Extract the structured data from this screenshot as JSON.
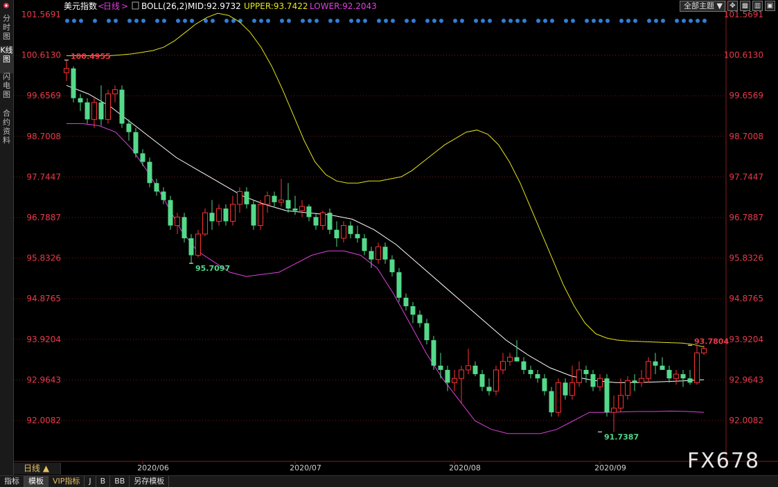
{
  "instrument": "美元指数",
  "period_label": "日线",
  "indicator": {
    "label": "BOLL(26,2)",
    "mid_label": "MID:92.9732",
    "upper_label": "UPPER:93.7422",
    "lower_label": "LOWER:92.2043"
  },
  "colors": {
    "up": "#ff3232",
    "down": "#54d98a",
    "mid": "#ffffff",
    "upper": "#e6e620",
    "lower": "#e040e0",
    "price_label": "#e83a4a",
    "grid": "#7a1a1a"
  },
  "sidebar_tabs": [
    "分时图",
    "K线图",
    "闪电图",
    "合约资料"
  ],
  "toolbar": {
    "theme_button": "全部主题",
    "theme_arrow": "▼"
  },
  "bottom_tabs": [
    "指标",
    "模板",
    "VIP指标",
    "J",
    "B",
    "BB",
    "另存模板"
  ],
  "period_tab": "日线 ▲",
  "watermark": "FX678",
  "chart_data": {
    "type": "candlestick",
    "title": "美元指数",
    "y_ticks": [
      "101.5691",
      "100.6130",
      "99.6569",
      "98.7008",
      "97.7447",
      "96.7887",
      "95.8326",
      "94.8765",
      "93.9204",
      "92.9643",
      "92.0082"
    ],
    "ylim": [
      91.4,
      101.6
    ],
    "x_ticks": [
      {
        "label": "2020/06",
        "index": 11
      },
      {
        "label": "2020/07",
        "index": 33
      },
      {
        "label": "2020/08",
        "index": 56
      },
      {
        "label": "2020/09",
        "index": 77
      }
    ],
    "annotations": [
      {
        "text": "100.4955",
        "index": 0,
        "value": 100.4955
      },
      {
        "text": "95.7097",
        "index": 18,
        "value": 95.7097
      },
      {
        "text": "91.7387",
        "index": 77,
        "value": 91.7387
      },
      {
        "text": "93.7804",
        "index": 90,
        "value": 93.7804
      }
    ],
    "ohlc": [
      [
        100.2,
        100.5,
        100.0,
        100.3
      ],
      [
        100.3,
        100.35,
        99.5,
        99.6
      ],
      [
        99.6,
        99.7,
        99.3,
        99.5
      ],
      [
        99.5,
        99.6,
        99.0,
        99.1
      ],
      [
        99.1,
        99.6,
        98.9,
        99.5
      ],
      [
        99.5,
        99.9,
        98.95,
        99.1
      ],
      [
        99.1,
        99.8,
        99.0,
        99.7
      ],
      [
        99.7,
        99.9,
        99.5,
        99.8
      ],
      [
        99.8,
        99.9,
        98.9,
        99.0
      ],
      [
        99.0,
        99.1,
        98.6,
        98.8
      ],
      [
        98.8,
        98.9,
        98.2,
        98.3
      ],
      [
        98.3,
        98.4,
        98.0,
        98.1
      ],
      [
        98.1,
        98.2,
        97.5,
        97.6
      ],
      [
        97.6,
        97.7,
        97.3,
        97.4
      ],
      [
        97.4,
        97.5,
        97.1,
        97.2
      ],
      [
        97.2,
        97.3,
        96.5,
        96.6
      ],
      [
        96.6,
        96.9,
        96.4,
        96.8
      ],
      [
        96.8,
        96.9,
        96.2,
        96.3
      ],
      [
        96.3,
        96.4,
        95.7,
        95.9
      ],
      [
        95.9,
        96.5,
        95.85,
        96.4
      ],
      [
        96.4,
        97.0,
        96.35,
        96.9
      ],
      [
        96.9,
        97.2,
        96.5,
        96.7
      ],
      [
        96.7,
        97.1,
        96.6,
        97.0
      ],
      [
        97.0,
        97.1,
        96.6,
        96.7
      ],
      [
        96.7,
        97.3,
        96.6,
        97.1
      ],
      [
        97.1,
        97.5,
        96.9,
        97.4
      ],
      [
        97.4,
        97.5,
        97.0,
        97.1
      ],
      [
        97.1,
        97.2,
        96.5,
        96.6
      ],
      [
        96.6,
        97.2,
        96.5,
        97.1
      ],
      [
        97.1,
        97.4,
        96.9,
        97.3
      ],
      [
        97.3,
        97.4,
        97.05,
        97.15
      ],
      [
        97.15,
        97.7,
        97.05,
        97.2
      ],
      [
        97.2,
        97.6,
        96.9,
        97.0
      ],
      [
        97.0,
        97.3,
        96.85,
        96.95
      ],
      [
        96.95,
        97.2,
        96.8,
        97.05
      ],
      [
        97.05,
        97.1,
        96.7,
        96.8
      ],
      [
        96.8,
        96.9,
        96.5,
        96.6
      ],
      [
        96.6,
        96.95,
        96.5,
        96.9
      ],
      [
        96.9,
        97.0,
        96.4,
        96.5
      ],
      [
        96.5,
        96.7,
        96.1,
        96.3
      ],
      [
        96.3,
        96.7,
        96.2,
        96.6
      ],
      [
        96.6,
        96.7,
        96.3,
        96.4
      ],
      [
        96.4,
        96.6,
        96.2,
        96.3
      ],
      [
        96.3,
        96.4,
        95.9,
        96.0
      ],
      [
        96.0,
        96.1,
        95.6,
        95.8
      ],
      [
        95.8,
        96.2,
        95.7,
        96.1
      ],
      [
        96.1,
        96.2,
        95.7,
        95.8
      ],
      [
        95.8,
        95.9,
        95.4,
        95.5
      ],
      [
        95.5,
        95.6,
        94.8,
        94.9
      ],
      [
        94.9,
        95.0,
        94.6,
        94.7
      ],
      [
        94.7,
        94.8,
        94.3,
        94.5
      ],
      [
        94.5,
        94.6,
        94.2,
        94.3
      ],
      [
        94.3,
        94.4,
        93.8,
        93.9
      ],
      [
        93.9,
        94.0,
        93.2,
        93.3
      ],
      [
        93.3,
        93.6,
        93.0,
        93.2
      ],
      [
        93.2,
        93.3,
        92.7,
        92.9
      ],
      [
        92.9,
        93.2,
        92.7,
        93.0
      ],
      [
        93.0,
        93.3,
        92.4,
        93.2
      ],
      [
        93.2,
        93.7,
        93.1,
        93.3
      ],
      [
        93.3,
        93.4,
        93.05,
        93.1
      ],
      [
        93.1,
        93.2,
        92.7,
        92.8
      ],
      [
        92.8,
        93.0,
        92.6,
        92.7
      ],
      [
        92.7,
        93.3,
        92.6,
        93.2
      ],
      [
        93.2,
        93.6,
        93.1,
        93.4
      ],
      [
        93.4,
        93.6,
        93.3,
        93.5
      ],
      [
        93.5,
        93.9,
        93.4,
        93.4
      ],
      [
        93.4,
        93.5,
        93.1,
        93.2
      ],
      [
        93.2,
        93.3,
        93.0,
        93.1
      ],
      [
        93.1,
        93.2,
        92.9,
        93.0
      ],
      [
        93.0,
        93.1,
        92.6,
        92.7
      ],
      [
        92.7,
        92.8,
        92.1,
        92.2
      ],
      [
        92.2,
        93.0,
        92.1,
        92.9
      ],
      [
        92.9,
        93.0,
        92.5,
        92.6
      ],
      [
        92.6,
        93.3,
        92.5,
        92.9
      ],
      [
        92.9,
        93.4,
        92.8,
        93.2
      ],
      [
        93.2,
        93.3,
        92.9,
        93.1
      ],
      [
        93.1,
        93.2,
        92.7,
        92.8
      ],
      [
        92.8,
        93.1,
        92.7,
        93.0
      ],
      [
        93.0,
        93.1,
        92.1,
        92.2
      ],
      [
        92.2,
        92.6,
        91.74,
        92.3
      ],
      [
        92.3,
        93.0,
        92.2,
        92.6
      ],
      [
        92.6,
        93.05,
        92.5,
        92.95
      ],
      [
        92.95,
        93.1,
        92.7,
        92.9
      ],
      [
        92.9,
        93.2,
        92.8,
        93.0
      ],
      [
        93.0,
        93.5,
        92.9,
        93.4
      ],
      [
        93.4,
        93.6,
        93.1,
        93.3
      ],
      [
        93.3,
        93.5,
        93.2,
        93.2
      ],
      [
        93.2,
        93.3,
        92.9,
        93.0
      ],
      [
        93.0,
        93.2,
        92.85,
        93.1
      ],
      [
        93.1,
        93.2,
        92.8,
        93.0
      ],
      [
        93.0,
        93.2,
        92.85,
        92.9
      ],
      [
        92.9,
        93.8,
        92.85,
        93.6
      ],
      [
        93.6,
        93.78,
        93.55,
        93.7
      ]
    ],
    "series": [
      {
        "name": "UPPER",
        "values": [
          100.6,
          100.6,
          100.6,
          100.6,
          100.6,
          100.62,
          100.64,
          100.68,
          100.72,
          100.8,
          100.95,
          101.15,
          101.35,
          101.5,
          101.6,
          101.55,
          101.4,
          101.15,
          100.8,
          100.35,
          99.8,
          99.2,
          98.6,
          98.1,
          97.8,
          97.65,
          97.6,
          97.6,
          97.65,
          97.65,
          97.7,
          97.75,
          97.9,
          98.1,
          98.3,
          98.5,
          98.65,
          98.8,
          98.85,
          98.75,
          98.5,
          98.1,
          97.6,
          97.0,
          96.4,
          95.8,
          95.2,
          94.7,
          94.3,
          94.05,
          93.95,
          93.9,
          93.88,
          93.87,
          93.86,
          93.85,
          93.84,
          93.83,
          93.8,
          93.74
        ]
      },
      {
        "name": "MID",
        "values": [
          99.9,
          99.7,
          99.4,
          99.0,
          98.6,
          98.2,
          97.9,
          97.6,
          97.3,
          97.1,
          96.95,
          96.9,
          96.85,
          96.75,
          96.5,
          96.15,
          95.7,
          95.25,
          94.8,
          94.35,
          93.9,
          93.55,
          93.25,
          93.05,
          92.95,
          92.9,
          92.9,
          92.92,
          92.94,
          92.97
        ]
      },
      {
        "name": "LOWER",
        "values": [
          99.0,
          99.0,
          98.95,
          98.8,
          98.4,
          97.85,
          97.2,
          96.5,
          96.0,
          95.75,
          95.5,
          95.4,
          95.45,
          95.5,
          95.7,
          95.9,
          96.0,
          96.0,
          95.9,
          95.6,
          95.0,
          94.3,
          93.6,
          93.0,
          92.5,
          92.0,
          91.8,
          91.7,
          91.7,
          91.7,
          91.8,
          92.0,
          92.2,
          92.2,
          92.21,
          92.22,
          92.22,
          92.23,
          92.22,
          92.2
        ]
      }
    ]
  }
}
